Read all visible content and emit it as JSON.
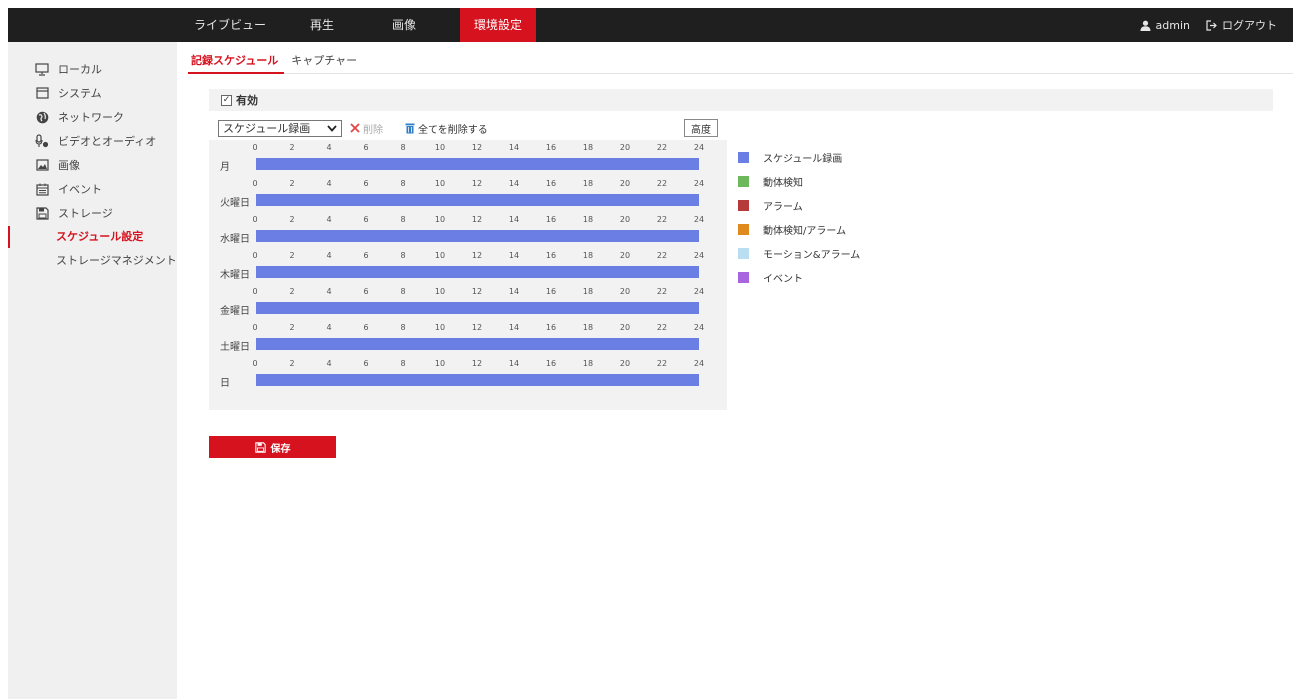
{
  "topnav": {
    "items": [
      {
        "label": "ライブビュー"
      },
      {
        "label": "再生"
      },
      {
        "label": "画像"
      },
      {
        "label": "環境設定"
      }
    ]
  },
  "user": {
    "name": "admin",
    "logout_label": "ログアウト"
  },
  "sidebar": {
    "items": [
      {
        "label": "ローカル",
        "icon": "monitor-icon"
      },
      {
        "label": "システム",
        "icon": "window-icon"
      },
      {
        "label": "ネットワーク",
        "icon": "globe-icon"
      },
      {
        "label": "ビデオとオーディオ",
        "icon": "mic-icon"
      },
      {
        "label": "画像",
        "icon": "image-icon"
      },
      {
        "label": "イベント",
        "icon": "calendar-icon"
      },
      {
        "label": "ストレージ",
        "icon": "save-icon"
      }
    ],
    "subitems": [
      {
        "label": "スケジュール設定"
      },
      {
        "label": "ストレージマネジメント"
      }
    ]
  },
  "tabs": [
    {
      "label": "記録スケジュール"
    },
    {
      "label": "キャプチャー"
    }
  ],
  "enable": {
    "label": "有効",
    "checked": true
  },
  "toolbar": {
    "select_value": "スケジュール録画",
    "delete_label": "削除",
    "delete_all_label": "全てを削除する",
    "advanced_label": "高度"
  },
  "hour_ticks": [
    "0",
    "2",
    "4",
    "6",
    "8",
    "10",
    "12",
    "14",
    "16",
    "18",
    "20",
    "22",
    "24"
  ],
  "schedule": [
    {
      "day": "月",
      "start": 0,
      "end": 24
    },
    {
      "day": "火曜日",
      "start": 0,
      "end": 24
    },
    {
      "day": "水曜日",
      "start": 0,
      "end": 24
    },
    {
      "day": "木曜日",
      "start": 0,
      "end": 24
    },
    {
      "day": "金曜日",
      "start": 0,
      "end": 24
    },
    {
      "day": "土曜日",
      "start": 0,
      "end": 24
    },
    {
      "day": "日",
      "start": 0,
      "end": 24
    }
  ],
  "legend": [
    {
      "label": "スケジュール録画",
      "color": "#6b7ee4"
    },
    {
      "label": "動体検知",
      "color": "#6cb85a"
    },
    {
      "label": "アラーム",
      "color": "#b73a3a"
    },
    {
      "label": "動体検知/アラーム",
      "color": "#e08a1e"
    },
    {
      "label": "モーション&アラーム",
      "color": "#b9def2"
    },
    {
      "label": "イベント",
      "color": "#a865e0"
    }
  ],
  "save_label": "保存",
  "colors": {
    "accent": "#d6121f",
    "bar": "#6b7ee4"
  }
}
